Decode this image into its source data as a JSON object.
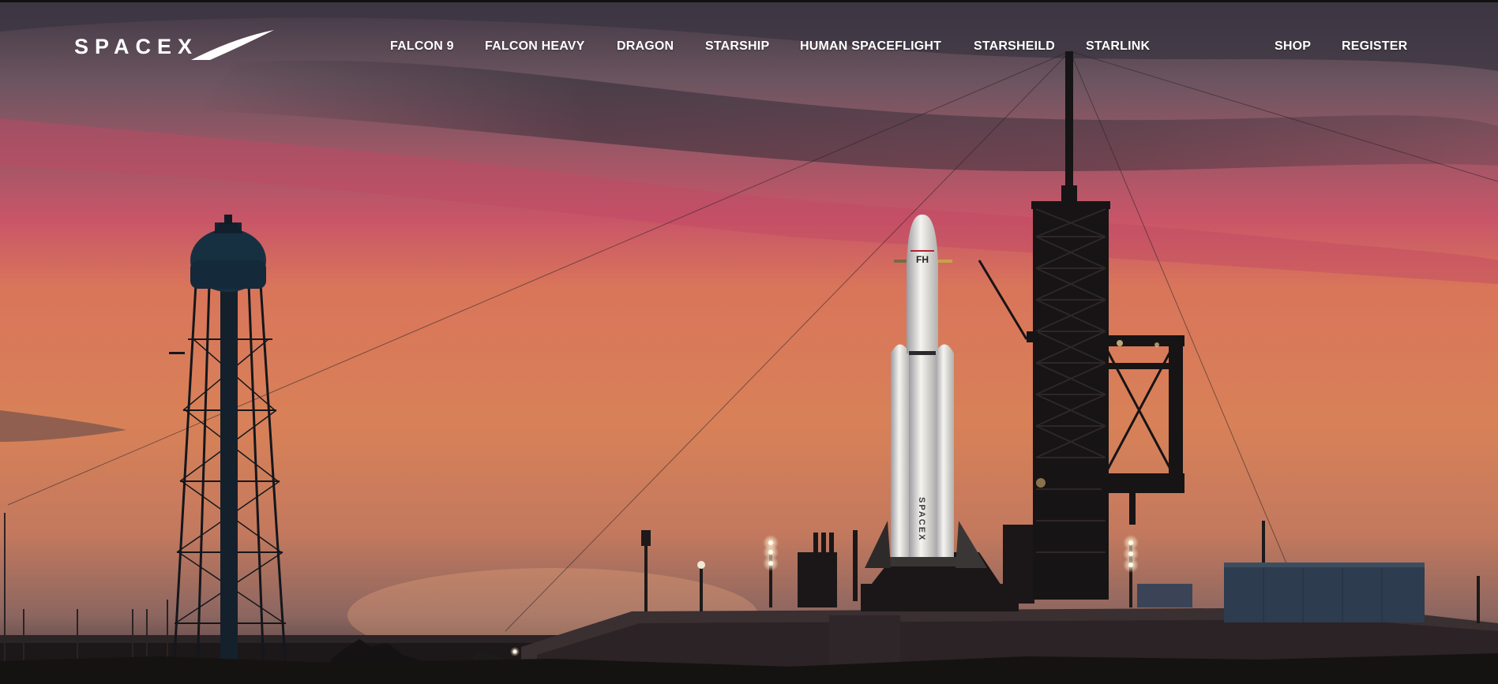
{
  "brand": {
    "logo_text": "SPACEX"
  },
  "nav": {
    "items": [
      {
        "label": "FALCON 9"
      },
      {
        "label": "FALCON HEAVY"
      },
      {
        "label": "DRAGON"
      },
      {
        "label": "STARSHIP"
      },
      {
        "label": "HUMAN SPACEFLIGHT"
      },
      {
        "label": "STARSHEILD"
      },
      {
        "label": "STARLINK"
      }
    ],
    "right": [
      {
        "label": "SHOP"
      },
      {
        "label": "REGISTER"
      }
    ]
  },
  "rocket_markings": {
    "nose": "FH",
    "side": "SPACEX"
  },
  "colors": {
    "sky_top": "#4a3f4c",
    "sky_pink": "#c9566a",
    "sky_orange": "#d97a52",
    "horizon": "#b87258",
    "silhouette": "#1a1718",
    "nav_text": "#ffffff"
  }
}
